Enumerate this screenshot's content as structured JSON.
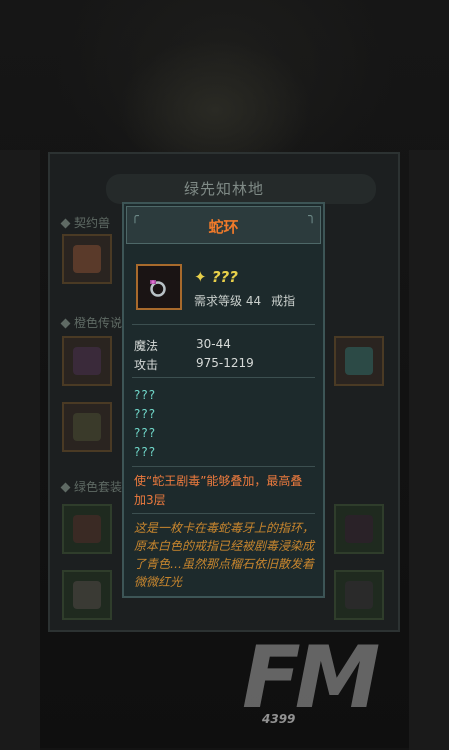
{
  "background": {
    "bag_title": "绿先知林地"
  },
  "bag_sections": [
    {
      "label": "契约兽"
    },
    {
      "label": "橙色传说"
    },
    {
      "label": "绿色套装"
    }
  ],
  "tooltip": {
    "name": "蛇环",
    "rarity": "???",
    "level_req": "需求等级 44",
    "item_type": "戒指",
    "stats": [
      {
        "name": "魔法",
        "value": "30-44"
      },
      {
        "name": "攻击",
        "value": "975-1219"
      }
    ],
    "unknown_lines": [
      "???",
      "???",
      "???",
      "???"
    ],
    "effect": "使“蛇王剧毒”能够叠加，最高叠加3层",
    "lore": "这是一枚卡在毒蛇毒牙上的指环，原本白色的戒指已经被剧毒浸染成了青色…虽然那点榴石依旧散发着微微红光"
  },
  "watermark": {
    "logo": "FM",
    "brand": "4399"
  },
  "colors": {
    "name": "#f07a2a",
    "rarity": "#e8d04a",
    "unknown": "#6fd6c8",
    "effect": "#ec7a3e",
    "lore": "#c8862e",
    "frame": "#3d5556"
  },
  "icons": {
    "item": "ring-icon",
    "rarity": "rarity-star-icon"
  }
}
